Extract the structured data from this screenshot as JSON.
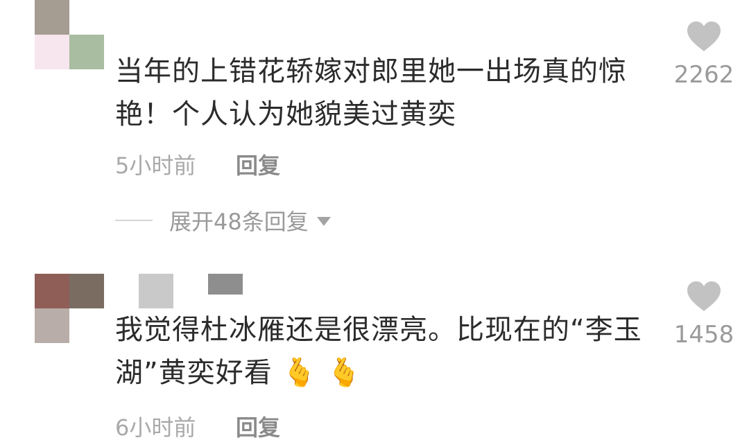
{
  "comments": [
    {
      "avatar_colors": [
        "#a59d92",
        "#ffffff",
        "#f7e6ee",
        "#a9bda1"
      ],
      "text_line1": "当年的上错花轿嫁对郎里她一出场真的惊",
      "text_line2": "艳！个人认为她貌美过黄奕",
      "time": "5小时前",
      "reply_label": "回复",
      "likes": "2262",
      "expand_label": "展开48条回复"
    },
    {
      "avatar_colors": [
        "#8e5e57",
        "#7b6c61",
        "#ffffff",
        "#b9ada9"
      ],
      "header_colors": [
        "#c9c9c9",
        "#8e8e8e"
      ],
      "text_line1": "我觉得杜冰雁还是很漂亮。比现在的“李玉",
      "text_line2": "湖”黄奕好看",
      "emojis": [
        "🫰",
        "🫰"
      ],
      "time": "6小时前",
      "reply_label": "回复",
      "likes": "1458"
    }
  ],
  "icons": {
    "like": "heart-icon",
    "expand": "caret-down-icon",
    "emoji": "finger-heart-emoji"
  }
}
